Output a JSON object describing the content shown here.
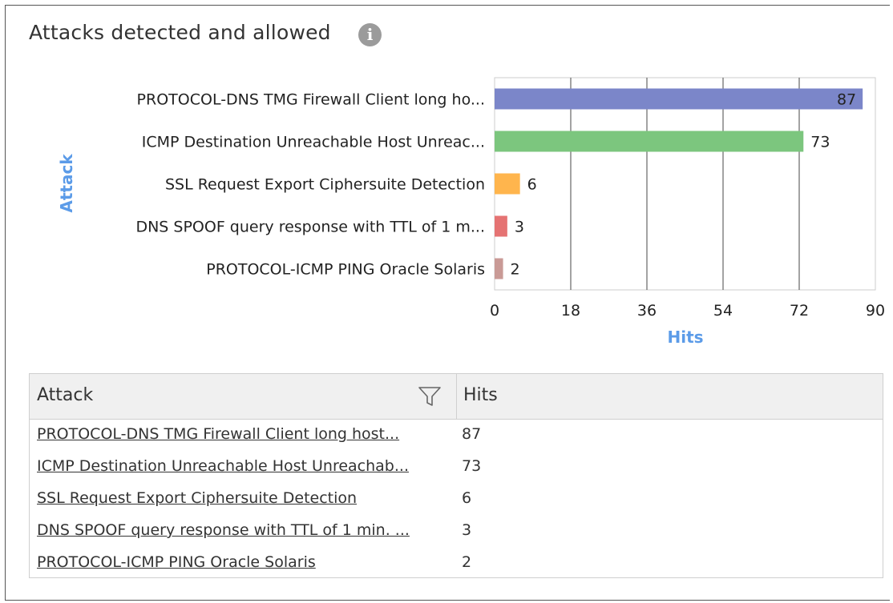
{
  "widget": {
    "title": "Attacks detected and allowed",
    "info_icon": "info-icon"
  },
  "chart_data": {
    "type": "bar",
    "orientation": "horizontal",
    "categories": [
      "PROTOCOL-DNS TMG Firewall Client long ho...",
      "ICMP Destination Unreachable Host Unreac...",
      "SSL Request Export Ciphersuite Detection",
      "DNS SPOOF query response with TTL of 1 m...",
      "PROTOCOL-ICMP PING Oracle Solaris"
    ],
    "values": [
      87,
      73,
      6,
      3,
      2
    ],
    "colors": [
      "#7b86c9",
      "#7cc67e",
      "#ffb54d",
      "#e57373",
      "#c99a96"
    ],
    "xlabel": "Hits",
    "ylabel": "Attack",
    "xlim": [
      0,
      90
    ],
    "xticks": [
      "0",
      "18",
      "36",
      "54",
      "72",
      "90"
    ],
    "grid": true,
    "axis_label_color": "#5b9be8"
  },
  "table": {
    "columns": [
      "Attack",
      "Hits"
    ],
    "filter_icon": "filter-icon",
    "rows": [
      {
        "attack": "PROTOCOL-DNS TMG Firewall Client long host...",
        "hits": "87"
      },
      {
        "attack": "ICMP Destination Unreachable Host Unreachab...",
        "hits": "73"
      },
      {
        "attack": "SSL Request Export Ciphersuite Detection",
        "hits": "6"
      },
      {
        "attack": "DNS SPOOF query response with TTL of 1 min. ...",
        "hits": "3"
      },
      {
        "attack": "PROTOCOL-ICMP PING Oracle Solaris",
        "hits": "2"
      }
    ]
  }
}
